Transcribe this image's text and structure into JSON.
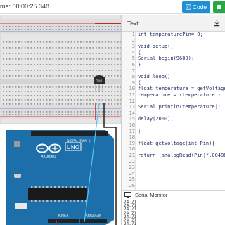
{
  "toolbar": {
    "timer": "00:00:25.348",
    "code_label": "Code",
    "code_icon": "code-editor-icon",
    "start_icon": "stop-square-icon",
    "start_color": "#27a745",
    "accent": "#1f8fd6"
  },
  "circuit": {
    "sensor_label": "TMP",
    "board_name": "UNO",
    "board_brand": "ARDUINO",
    "digital_label": "DIGITAL (PWM~)",
    "power_label": "POWER",
    "analog_label": "ANALOG IN",
    "board_color": "#1c6fa8"
  },
  "code_panel": {
    "title": "Text",
    "download_icon": "download-icon",
    "lines": [
      {
        "n": "1",
        "text": "int temperaturePin= 0;"
      },
      {
        "n": "2",
        "text": ""
      },
      {
        "n": "3",
        "text": "void setup()"
      },
      {
        "n": "4",
        "text": "{"
      },
      {
        "n": "5",
        "text": "Serial.begin(9600);"
      },
      {
        "n": "6",
        "text": "}"
      },
      {
        "n": "7",
        "text": ""
      },
      {
        "n": "8",
        "text": "void loop()"
      },
      {
        "n": "9",
        "text": "{"
      },
      {
        "n": "10",
        "text": "float temperature = getVoltage(te"
      },
      {
        "n": "11",
        "text": "temperature = (temperature - .5)"
      },
      {
        "n": "12",
        "text": ""
      },
      {
        "n": "13",
        "text": "Serial.println(temperature);"
      },
      {
        "n": "14",
        "text": ""
      },
      {
        "n": "15",
        "text": "delay(2000);"
      },
      {
        "n": "16",
        "text": ""
      },
      {
        "n": "17",
        "text": "}"
      },
      {
        "n": "18",
        "text": ""
      },
      {
        "n": "19",
        "text": "float getVoltage(int Pin){"
      },
      {
        "n": "20",
        "text": ""
      },
      {
        "n": "21",
        "text": "return (analogRead(Pin)*.0048828"
      },
      {
        "n": "22",
        "text": ""
      },
      {
        "n": "23",
        "text": ""
      },
      {
        "n": "24",
        "text": ""
      },
      {
        "n": "25",
        "text": ""
      },
      {
        "n": "26",
        "text": ""
      }
    ]
  },
  "serial_monitor": {
    "title": "Serial Monitor",
    "icon": "monitor-icon",
    "lines": [
      "24.71",
      "24.71",
      "24.71",
      "24.71",
      "24.71",
      "24.71",
      "24.71"
    ]
  }
}
